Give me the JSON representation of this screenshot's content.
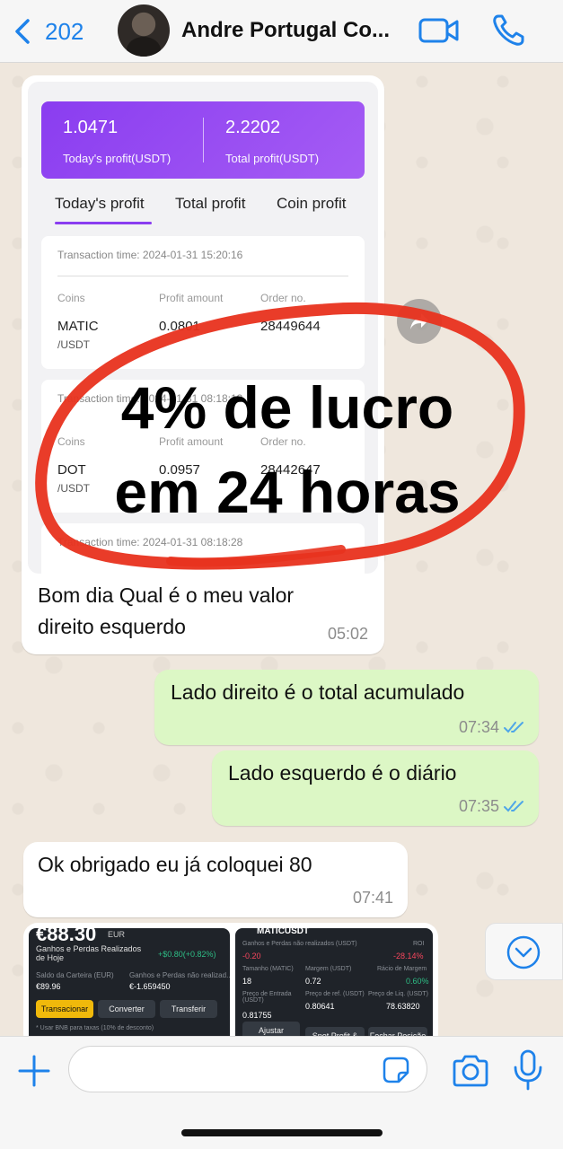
{
  "header": {
    "back_count": "202",
    "contact_name": "Andre Portugal Co...",
    "accent_color": "#1e82ea"
  },
  "chat": {
    "image_message": {
      "screenshot": {
        "today_profit_value": "1.0471",
        "today_profit_label": "Today's profit(USDT)",
        "total_profit_value": "2.2202",
        "total_profit_label": "Total profit(USDT)",
        "tabs": [
          "Today's profit",
          "Total profit",
          "Coin profit"
        ],
        "column_headers": [
          "Coins",
          "Profit amount",
          "Order no."
        ],
        "transactions": [
          {
            "time": "Transaction time: 2024-01-31 15:20:16",
            "coin": "MATIC",
            "pair": "/USDT",
            "profit": "0.0801",
            "order": "28449644"
          },
          {
            "time": "Transaction time: 2024-01-31 08:18:13",
            "coin": "DOT",
            "pair": "/USDT",
            "profit": "0.0957",
            "order": "28442647"
          },
          {
            "time": "Transaction time: 2024-01-31 08:18:28"
          }
        ]
      },
      "overlay_line1": "4% de lucro",
      "overlay_line2": "em 24 horas",
      "caption": "Bom dia Qual é o meu valor direito esquerdo",
      "time": "05:02"
    },
    "out_message_1": {
      "text": "Lado direito é o total acumulado",
      "time": "07:34"
    },
    "out_message_2": {
      "text": "Lado esquerdo é o diário",
      "time": "07:35"
    },
    "in_message_1": {
      "text": "Ok obrigado eu já coloquei 80",
      "time": "07:41"
    },
    "image_preview_left": {
      "balance": "€88.30",
      "currency": "EUR",
      "title": "Ganhos e Perdas Realizados de Hoje",
      "pnl": "+$0.80(+0.82%)",
      "wallet_label": "Saldo da Carteira (EUR)",
      "wallet_value": "€89.96",
      "unrealized_label": "Ganhos e Perdas não realizad...",
      "unrealized_value": "€-1.659450",
      "buttons": [
        "Transacionar",
        "Converter",
        "Transferir"
      ],
      "footer": "* Usar BNB para taxas (10% de desconto)"
    },
    "image_preview_right": {
      "symbol": "MATICUSDT",
      "unrealized_label": "Ganhos e Perdas não realizados (USDT)",
      "roi_label": "ROI",
      "unrealized_value": "-0.20",
      "roi_value": "-28.14%",
      "size_label": "Tamanho (MATIC)",
      "size_value": "18",
      "margin_label": "Margem (USDT)",
      "margin_value": "0.72",
      "margin_ratio_label": "Rácio de Margem",
      "margin_ratio_value": "0.60%",
      "entry_label": "Preço de Entrada (USDT)",
      "entry_value": "0.81755",
      "ref_label": "Preço de ref. (USDT)",
      "ref_value": "0.80641",
      "liq_label": "Preço de Liq. (USDT)",
      "liq_value": "78.63820",
      "buttons": [
        "Ajustar",
        "Spot Profit & Loss",
        "Fechar Posição"
      ]
    }
  },
  "input": {
    "placeholder": ""
  },
  "colors": {
    "incoming_bubble": "#ffffff",
    "outgoing_bubble": "#dcf7c5",
    "read_ticks": "#4fa6e8",
    "annotation_red": "#e8321e"
  }
}
